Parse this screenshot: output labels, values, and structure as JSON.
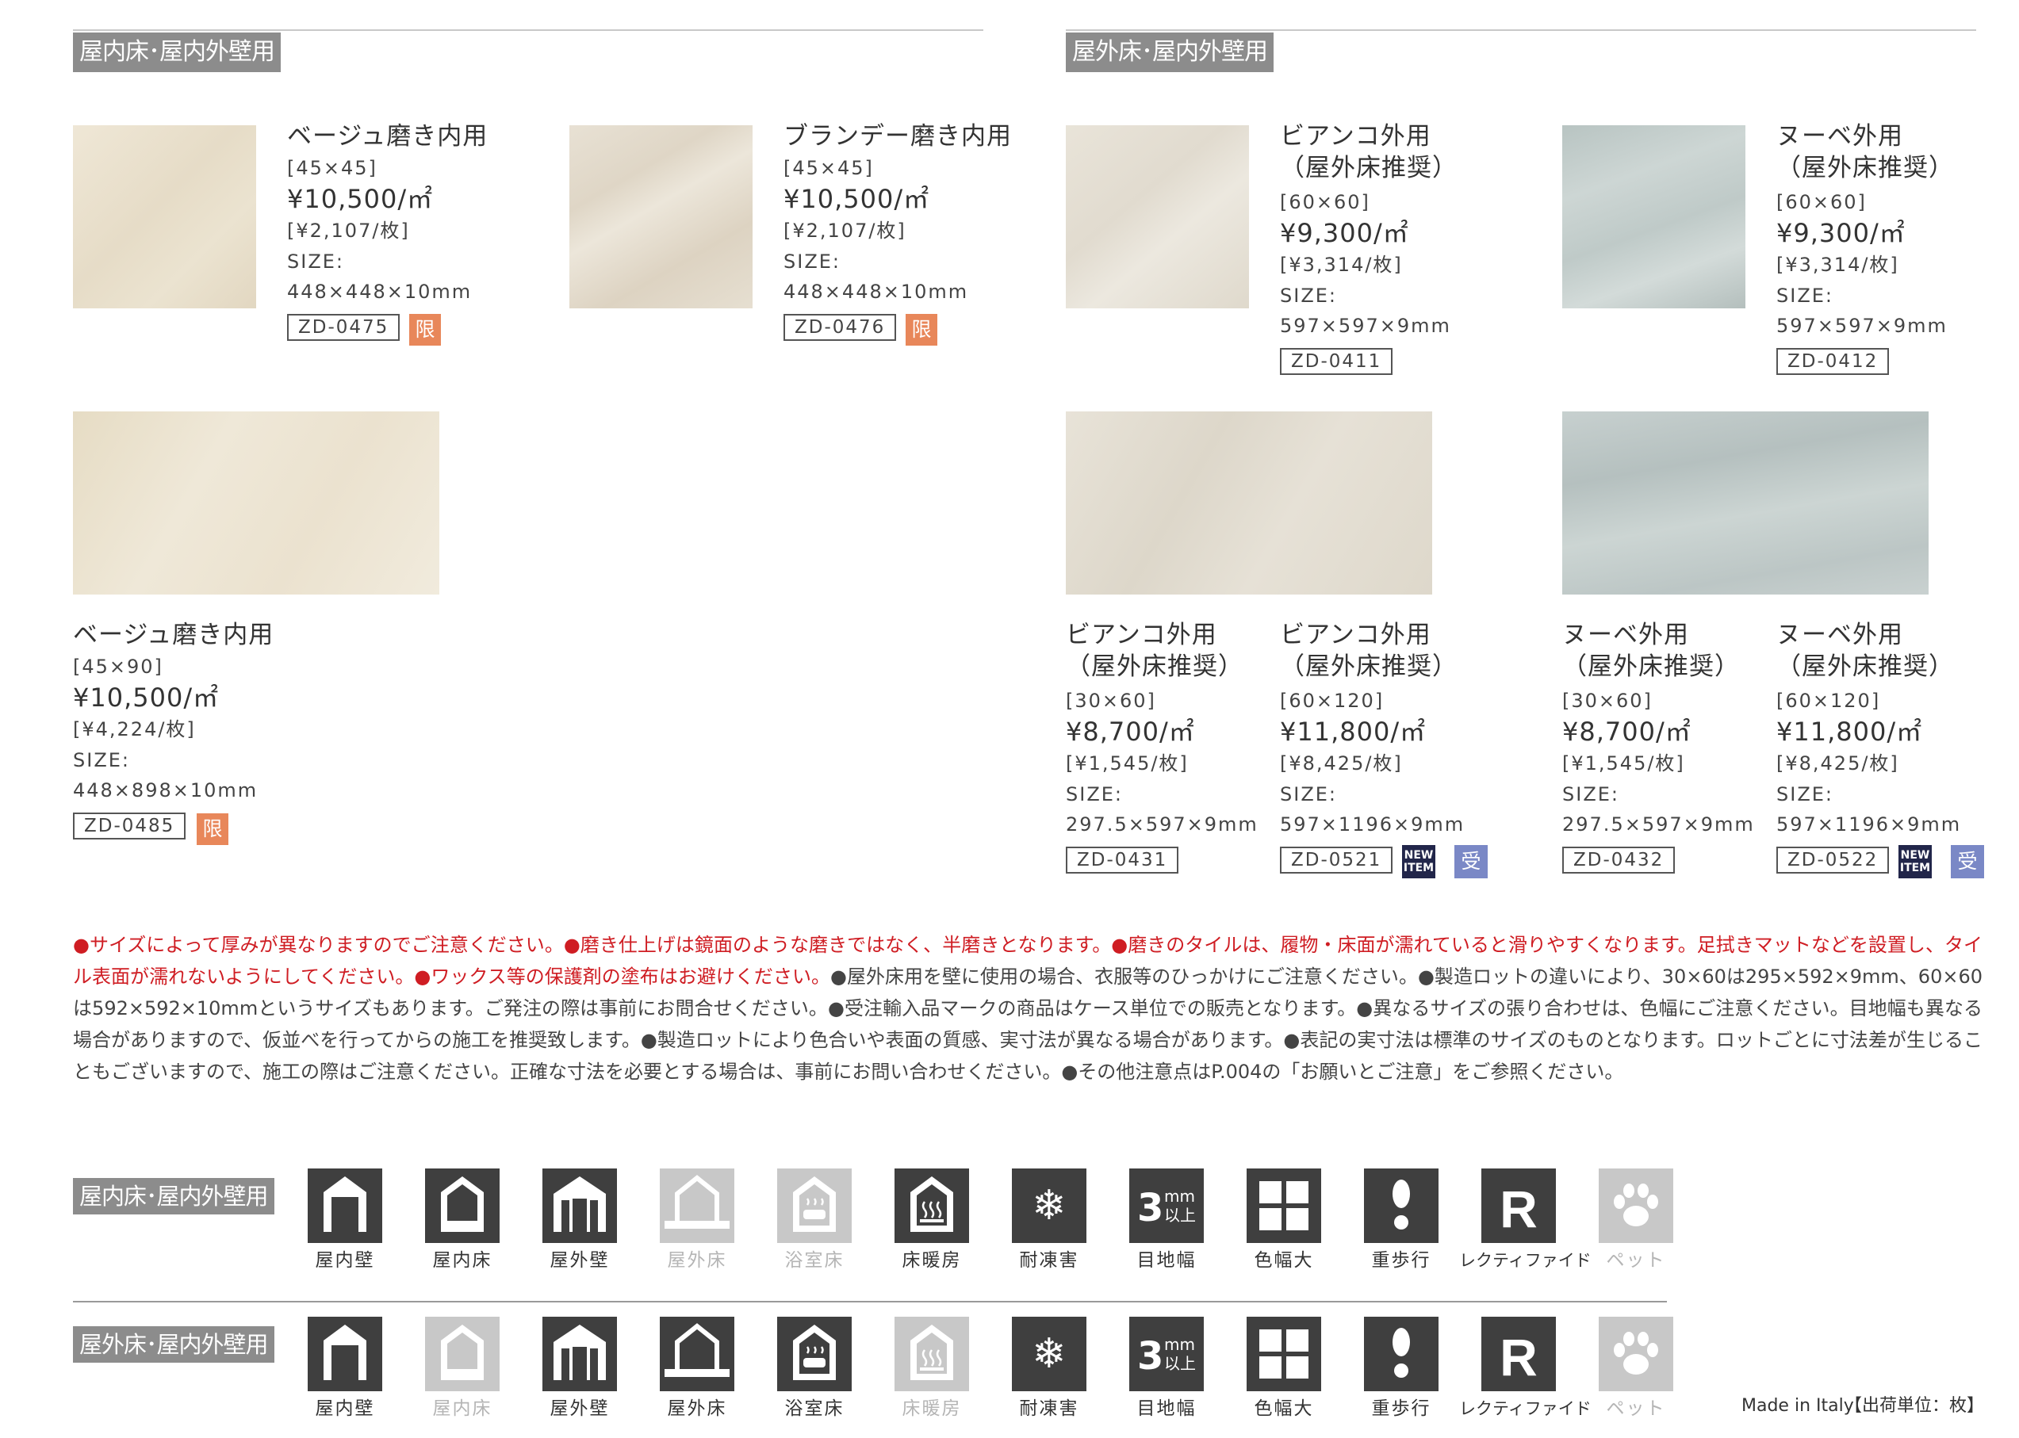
{
  "sections": {
    "indoor": "屋内床･屋内外壁用",
    "outdoor": "屋外床･屋内外壁用"
  },
  "products": [
    {
      "title": "ベージュ磨き内用",
      "size_cat": "[45×45]",
      "price": "¥10,500/㎡",
      "unit_price": "[¥2,107/枚]",
      "size_label": "SIZE:",
      "dims": "448×448×10mm",
      "code": "ZD-0475",
      "badge": "限"
    },
    {
      "title": "ブランデー磨き内用",
      "size_cat": "[45×45]",
      "price": "¥10,500/㎡",
      "unit_price": "[¥2,107/枚]",
      "size_label": "SIZE:",
      "dims": "448×448×10mm",
      "code": "ZD-0476",
      "badge": "限"
    },
    {
      "title": "ベージュ磨き内用",
      "size_cat": "[45×90]",
      "price": "¥10,500/㎡",
      "unit_price": "[¥4,224/枚]",
      "size_label": "SIZE:",
      "dims": "448×898×10mm",
      "code": "ZD-0485",
      "badge": "限"
    },
    {
      "title": "ビアンコ外用\n（屋外床推奨）",
      "size_cat": "[60×60]",
      "price": "¥9,300/㎡",
      "unit_price": "[¥3,314/枚]",
      "size_label": "SIZE:",
      "dims": "597×597×9mm",
      "code": "ZD-0411"
    },
    {
      "title": "ヌーベ外用\n（屋外床推奨）",
      "size_cat": "[60×60]",
      "price": "¥9,300/㎡",
      "unit_price": "[¥3,314/枚]",
      "size_label": "SIZE:",
      "dims": "597×597×9mm",
      "code": "ZD-0412"
    },
    {
      "title": "ビアンコ外用\n（屋外床推奨）",
      "size_cat": "[30×60]",
      "price": "¥8,700/㎡",
      "unit_price": "[¥1,545/枚]",
      "size_label": "SIZE:",
      "dims": "297.5×597×9mm",
      "code": "ZD-0431"
    },
    {
      "title": "ビアンコ外用\n（屋外床推奨）",
      "size_cat": "[60×120]",
      "price": "¥11,800/㎡",
      "unit_price": "[¥8,425/枚]",
      "size_label": "SIZE:",
      "dims": "597×1196×9mm",
      "code": "ZD-0521",
      "new_badge": "NEW ITEM",
      "badge2": "受"
    },
    {
      "title": "ヌーベ外用\n（屋外床推奨）",
      "size_cat": "[30×60]",
      "price": "¥8,700/㎡",
      "unit_price": "[¥1,545/枚]",
      "size_label": "SIZE:",
      "dims": "297.5×597×9mm",
      "code": "ZD-0432"
    },
    {
      "title": "ヌーベ外用\n（屋外床推奨）",
      "size_cat": "[60×120]",
      "price": "¥11,800/㎡",
      "unit_price": "[¥8,425/枚]",
      "size_label": "SIZE:",
      "dims": "597×1196×9mm",
      "code": "ZD-0522",
      "new_badge": "NEW ITEM",
      "badge2": "受"
    }
  ],
  "notes": {
    "red": "●サイズによって厚みが異なりますのでご注意ください。●磨き仕上げは鏡面のような磨きではなく、半磨きとなります。●磨きのタイルは、履物・床面が濡れていると滑りやすくなります。足拭きマットなどを設置し、タイル表面が濡れないようにしてください。●ワックス等の保護剤の塗布はお避けください。",
    "black": "●屋外床用を壁に使用の場合、衣服等のひっかけにご注意ください。●製造ロットの違いにより、30×60は295×592×9mm、60×60は592×592×10mmというサイズもあります。ご発注の際は事前にお問合せください。●受注輸入品マークの商品はケース単位での販売となります。●異なるサイズの張り合わせは、色幅にご注意ください。目地幅も異なる場合がありますので、仮並べを行ってからの施工を推奨致します。●製造ロットにより色合いや表面の質感、実寸法が異なる場合があります。●表記の実寸法は標準のサイズのものとなります。ロットごとに寸法差が生じることもございますので、施工の際はご注意ください。正確な寸法を必要とする場合は、事前にお問い合わせください。●その他注意点はP.004の「お願いとご注意」をご参照ください。"
  },
  "icon_labels": [
    "屋内壁",
    "屋内床",
    "屋外壁",
    "屋外床",
    "浴室床",
    "床暖房",
    "耐凍害",
    "目地幅",
    "色幅大",
    "重歩行",
    "レクティファイド",
    "ペット"
  ],
  "icon_names": [
    "indoor-wall-icon",
    "indoor-floor-icon",
    "outdoor-wall-icon",
    "outdoor-floor-icon",
    "bathroom-floor-icon",
    "floor-heating-icon",
    "frost-resistant-icon",
    "joint-width-icon",
    "color-variation-icon",
    "heavy-traffic-icon",
    "rectified-icon",
    "pet-icon"
  ],
  "icon_text": {
    "joint_num": "3",
    "joint_mm": "mm",
    "joint_above": "以上",
    "rectified": "R"
  },
  "icon_states": {
    "indoor": [
      true,
      true,
      true,
      false,
      false,
      true,
      true,
      true,
      true,
      true,
      true,
      false
    ],
    "outdoor": [
      true,
      false,
      true,
      true,
      true,
      false,
      true,
      true,
      true,
      true,
      true,
      false
    ]
  },
  "colors": {
    "label_bg": "#8c8c8c",
    "limited": "#e8875a",
    "new_item": "#22264a",
    "order_import": "#7a88c6",
    "warning_red": "#cf1d23",
    "icon_on": "#3f3f3f",
    "icon_off": "#c8c8c8"
  },
  "footer": {
    "made_in": "Made in Italy",
    "unit": "【出荷単位：枚】"
  }
}
